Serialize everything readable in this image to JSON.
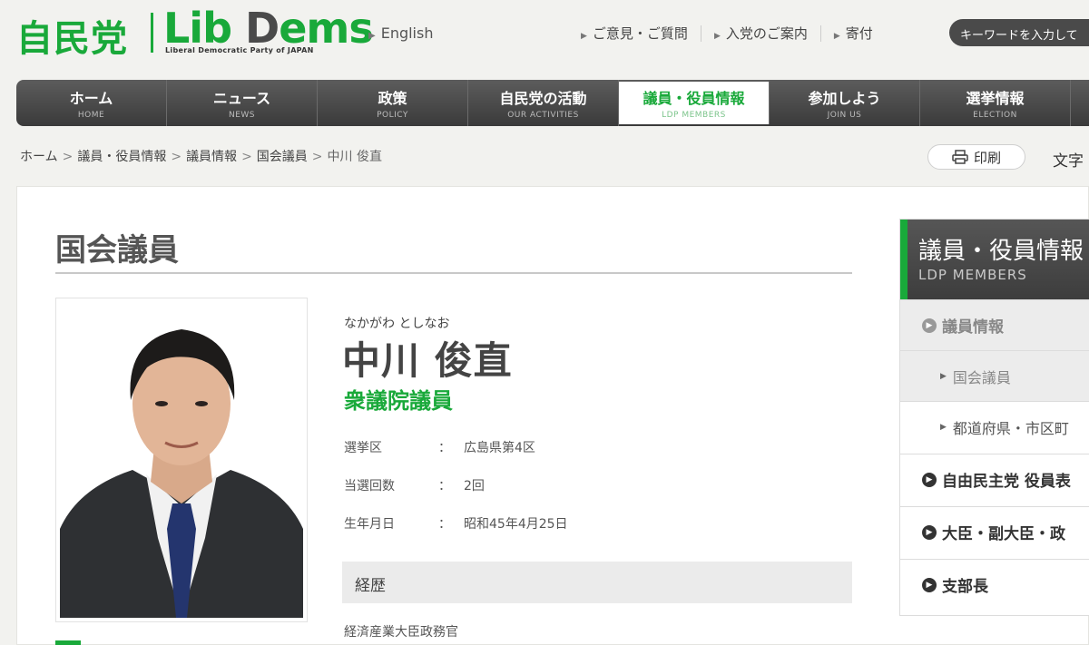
{
  "header": {
    "logo_jp": "自民党",
    "logo_en_prefix": "Lib ",
    "logo_en_d": "D",
    "logo_en_suffix": "ems",
    "logo_sub": "Liberal Democratic Party of JAPAN",
    "english_link": "English",
    "util_links": [
      "ご意見・ご質問",
      "入党のご案内",
      "寄付"
    ],
    "search_placeholder": "キーワードを入力して"
  },
  "nav": [
    {
      "jp": "ホーム",
      "en": "HOME"
    },
    {
      "jp": "ニュース",
      "en": "NEWS"
    },
    {
      "jp": "政策",
      "en": "POLICY"
    },
    {
      "jp": "自民党の活動",
      "en": "OUR ACTIVITIES"
    },
    {
      "jp": "議員・役員情報",
      "en": "LDP MEMBERS"
    },
    {
      "jp": "参加しよう",
      "en": "JOIN US"
    },
    {
      "jp": "選挙情報",
      "en": "ELECTION"
    }
  ],
  "breadcrumb": {
    "items": [
      "ホーム",
      "議員・役員情報",
      "議員情報",
      "国会議員"
    ],
    "current": "中川 俊直"
  },
  "print_label": "印刷",
  "font_size_label": "文字",
  "main": {
    "page_title": "国会議員",
    "furigana": "なかがわ としなお",
    "name": "中川 俊直",
    "house": "衆議院議員",
    "info": [
      {
        "label": "選挙区",
        "value": "広島県第4区"
      },
      {
        "label": "当選回数",
        "value": "2回"
      },
      {
        "label": "生年月日",
        "value": "昭和45年4月25日"
      }
    ],
    "info_colon": "：",
    "career_heading": "経歴",
    "career_items": [
      "経済産業大臣政務官"
    ]
  },
  "side": {
    "title_jp": "議員・役員情報",
    "title_en": "LDP MEMBERS",
    "items": [
      {
        "label": "議員情報"
      },
      {
        "label": "国会議員"
      },
      {
        "label": "都道府県・市区町"
      },
      {
        "label": "自由民主党 役員表"
      },
      {
        "label": "大臣・副大臣・政"
      },
      {
        "label": "支部長"
      }
    ]
  },
  "colors": {
    "brand_green": "#19a93a",
    "nav_dark": "#4a4a4a"
  }
}
